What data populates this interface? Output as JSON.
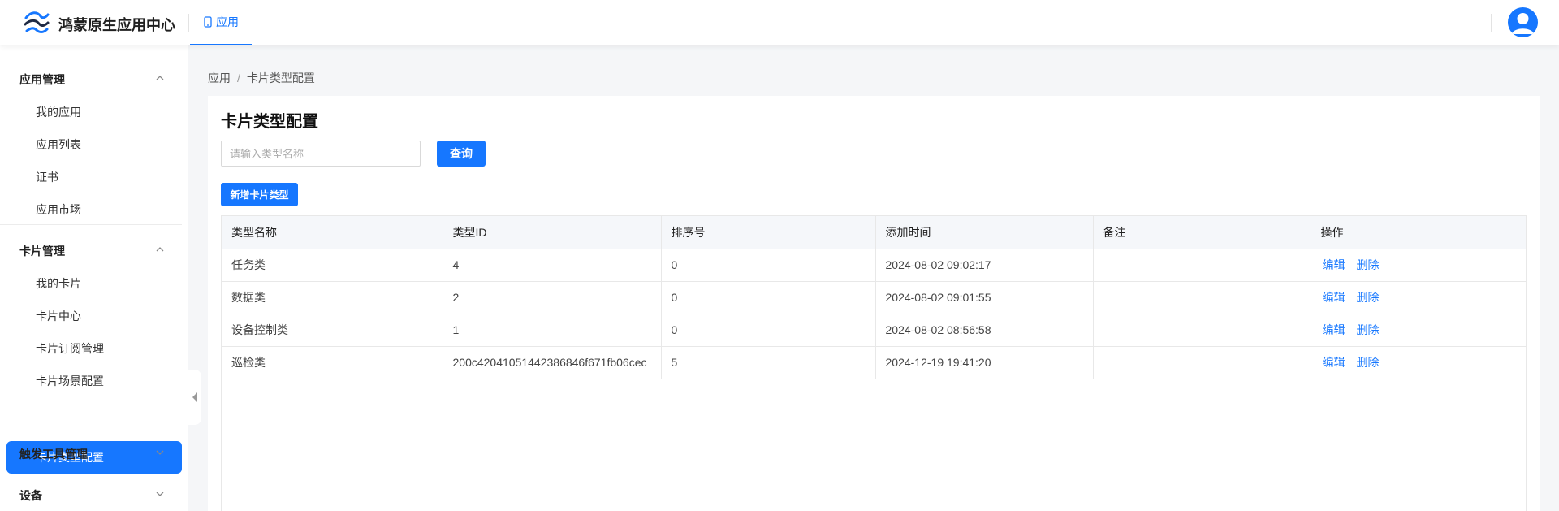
{
  "header": {
    "app_title": "鸿蒙原生应用中心",
    "nav_tab_label": "应用",
    "logo_icon": "logo-icon",
    "avatar_icon": "user-avatar-icon",
    "accent": "#1677ff"
  },
  "sidebar": {
    "groups": [
      {
        "label": "应用管理",
        "expanded": true,
        "items": [
          "我的应用",
          "应用列表",
          "证书",
          "应用市场"
        ]
      },
      {
        "label": "卡片管理",
        "expanded": true,
        "items": [
          "我的卡片",
          "卡片中心",
          "卡片订阅管理",
          "卡片场景配置",
          "卡片类型配置"
        ]
      },
      {
        "label": "触发工具管理",
        "expanded": false,
        "items": []
      },
      {
        "label": "设备",
        "expanded": false,
        "items": []
      }
    ],
    "active_item": "卡片类型配置"
  },
  "breadcrumb": {
    "root": "应用",
    "separator": "/",
    "current": "卡片类型配置"
  },
  "page": {
    "title": "卡片类型配置",
    "search_placeholder": "请输入类型名称",
    "query_label": "查询",
    "add_label": "新增卡片类型"
  },
  "table": {
    "columns": [
      "类型名称",
      "类型ID",
      "排序号",
      "添加时间",
      "备注",
      "操作"
    ],
    "rows": [
      {
        "name": "任务类",
        "id": "4",
        "order": "0",
        "added": "2024-08-02 09:02:17",
        "remark": ""
      },
      {
        "name": "数据类",
        "id": "2",
        "order": "0",
        "added": "2024-08-02 09:01:55",
        "remark": ""
      },
      {
        "name": "设备控制类",
        "id": "1",
        "order": "0",
        "added": "2024-08-02 08:56:58",
        "remark": ""
      },
      {
        "name": "巡检类",
        "id": "200c42041051442386846f671fb06cec",
        "order": "5",
        "added": "2024-12-19 19:41:20",
        "remark": ""
      }
    ],
    "actions": {
      "edit": "编辑",
      "delete": "删除"
    }
  }
}
